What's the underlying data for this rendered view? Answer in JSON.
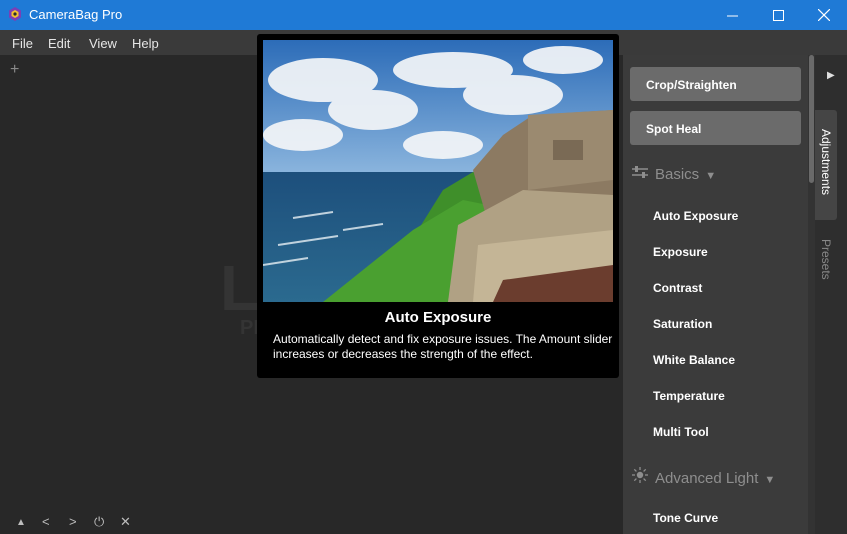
{
  "window": {
    "title": "CameraBag Pro",
    "controls": {
      "minimize": "minimize-icon",
      "maximize": "maximize-icon",
      "close": "close-icon"
    },
    "accent": "#1f7ad6"
  },
  "menu": [
    "File",
    "Edit",
    "View",
    "Help"
  ],
  "canvas": {
    "add_icon": "+",
    "background_logo": "LO",
    "background_sub": "PH",
    "bottom_icons": [
      "triangle-up-icon",
      "chevron-left-icon",
      "chevron-right-icon",
      "power-icon",
      "close-icon"
    ],
    "bottom_glyphs": [
      "▲",
      "<",
      ">",
      "⏻",
      "✕"
    ]
  },
  "tooltip": {
    "title": "Auto Exposure",
    "description": "Automatically detect and fix exposure issues. The Amount slider increases or decreases the strength of the effect."
  },
  "panel": {
    "buttons": [
      "Crop/Straighten",
      "Spot Heal"
    ],
    "basics": {
      "label": "Basics",
      "items": [
        "Auto Exposure",
        "Exposure",
        "Contrast",
        "Saturation",
        "White Balance",
        "Temperature",
        "Multi Tool"
      ]
    },
    "advanced_light": {
      "label": "Advanced Light",
      "items": [
        "Tone Curve"
      ]
    }
  },
  "side_tabs": [
    "Adjustments",
    "Presets"
  ]
}
